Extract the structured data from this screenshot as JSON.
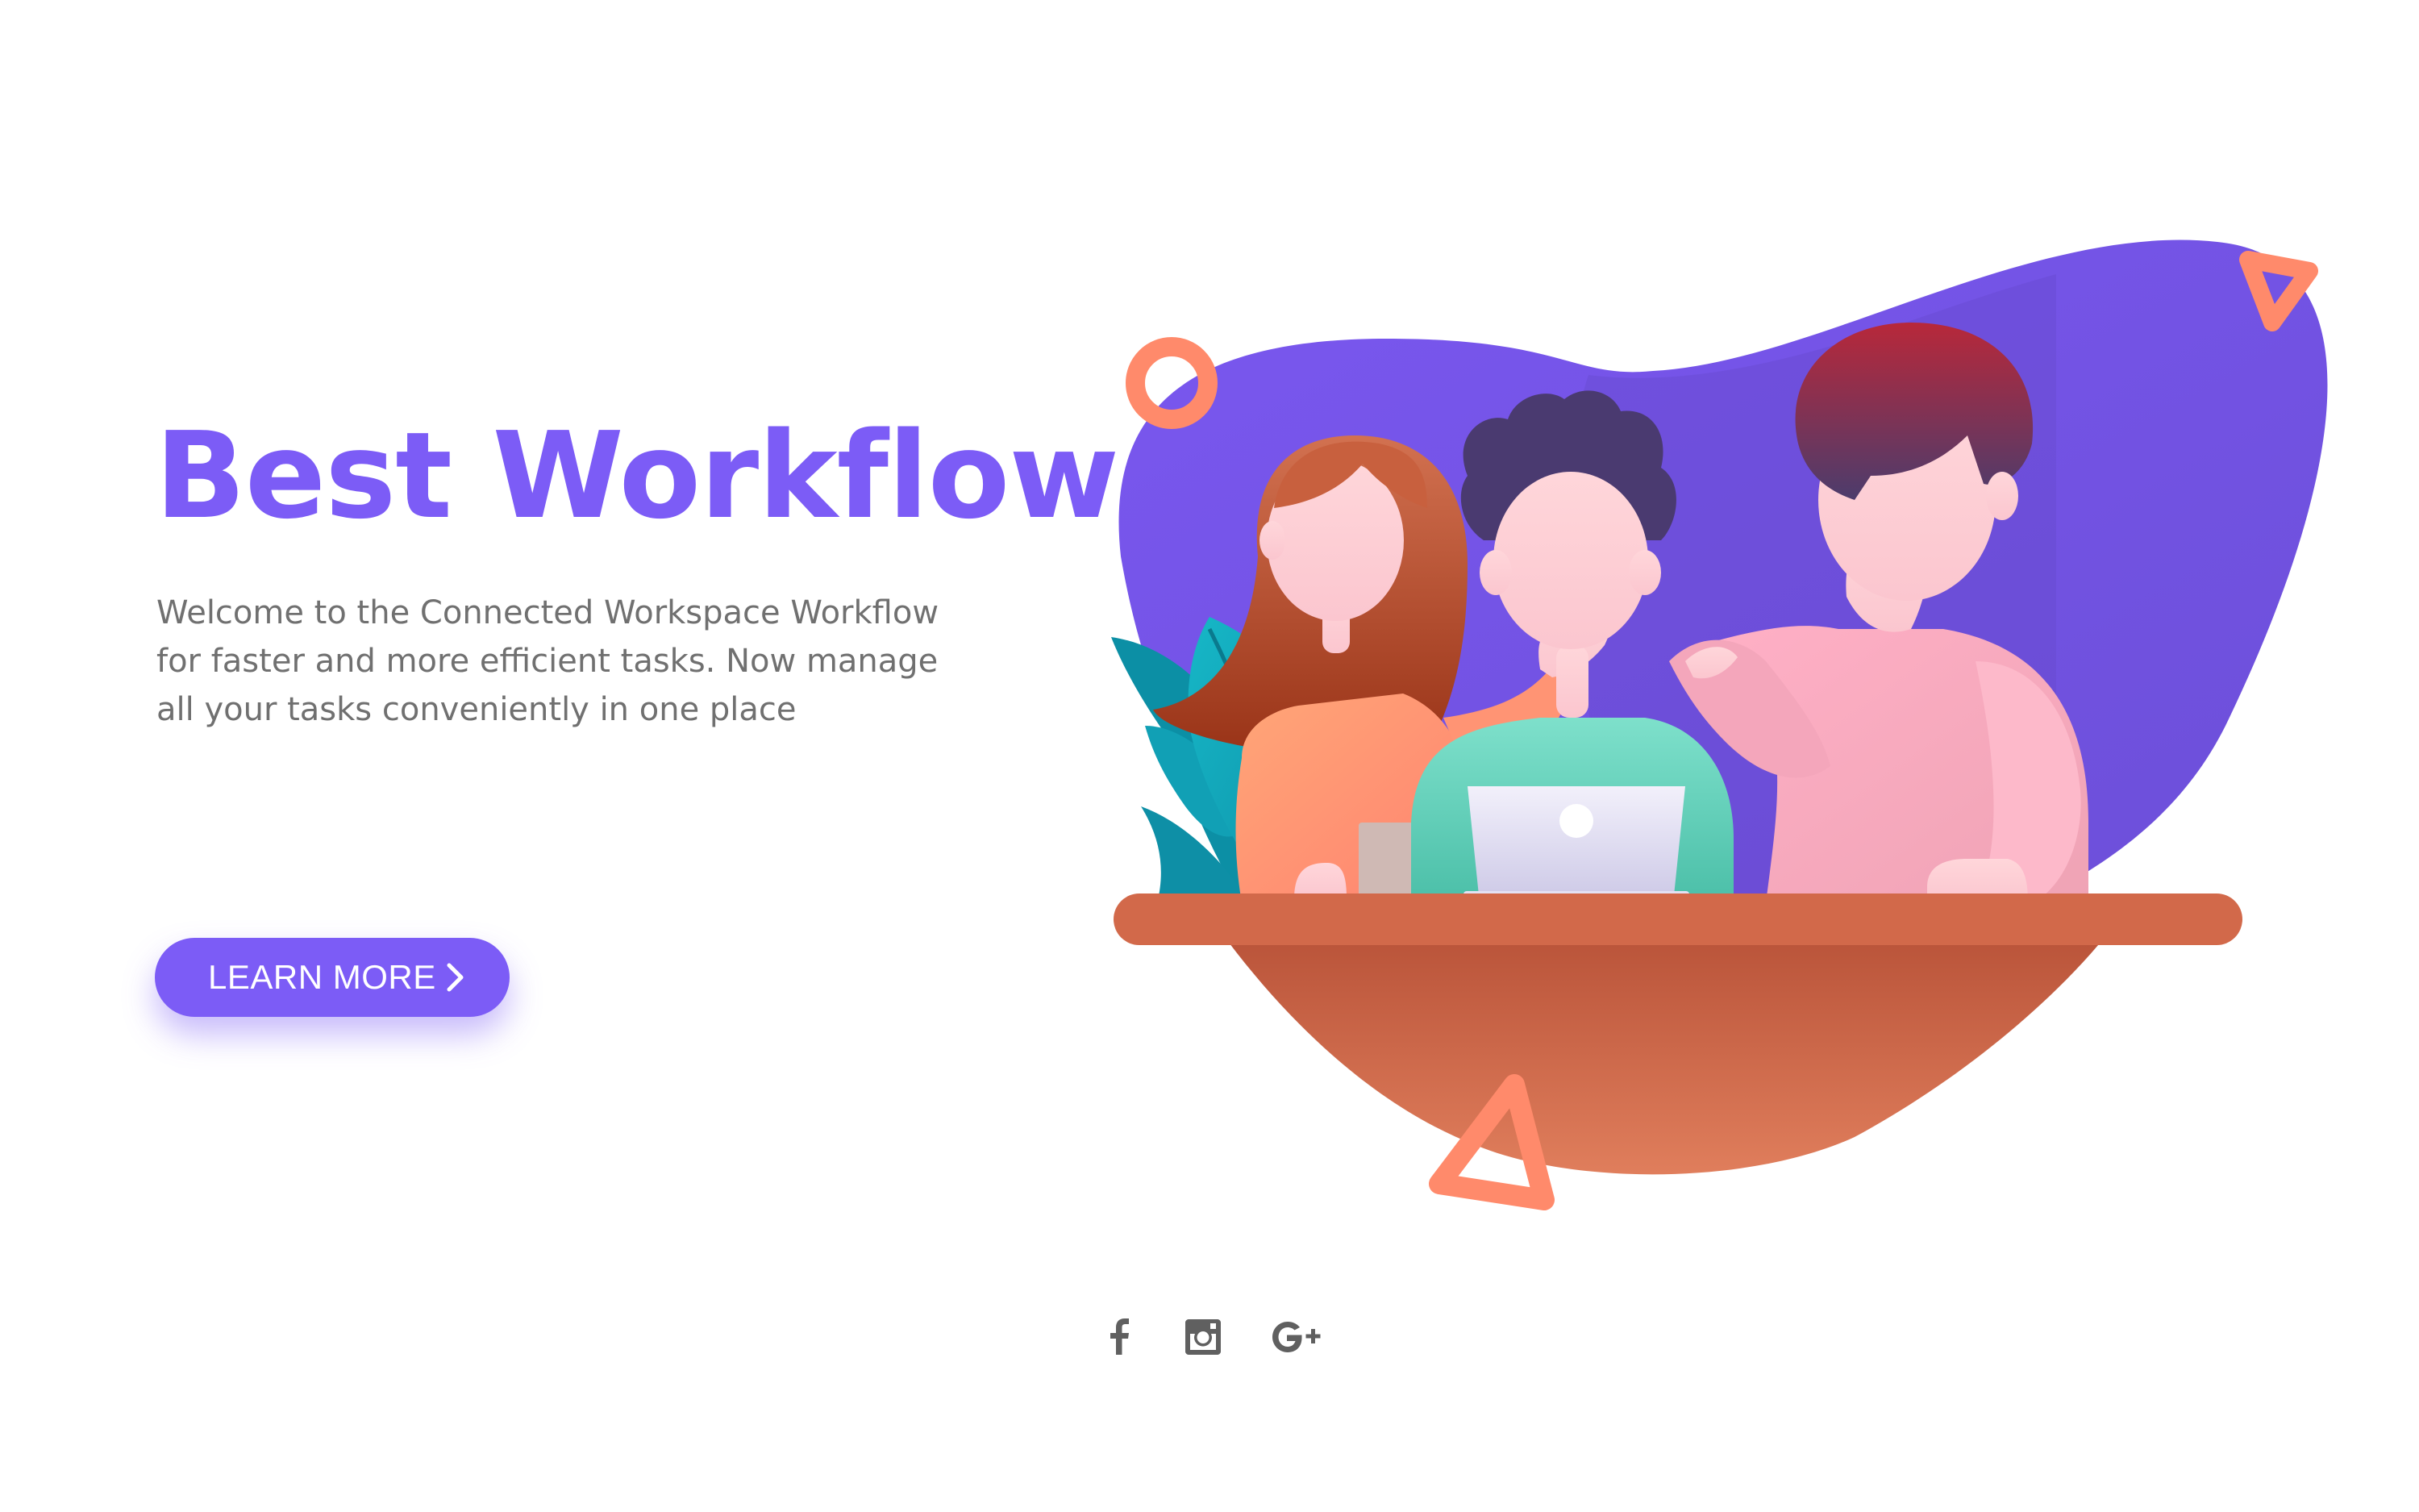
{
  "hero": {
    "title": "Best Workflow",
    "description": "Welcome to the Connected Workspace Workflow for faster and more efficient tasks. Now manage all your tasks conveniently in one place",
    "button_label": "LEARN MORE",
    "button_icon": "chevron-right-icon"
  },
  "social": [
    {
      "name": "facebook",
      "icon": "facebook-icon"
    },
    {
      "name": "instagram",
      "icon": "instagram-icon"
    },
    {
      "name": "google-plus",
      "icon": "google-plus-icon"
    }
  ],
  "colors": {
    "accent": "#7C5CF6",
    "text_muted": "#707070",
    "icon_gray": "#606060",
    "shape_orange": "#FF8A6B",
    "desk": "#D2694A",
    "background": "#FFFFFF"
  }
}
